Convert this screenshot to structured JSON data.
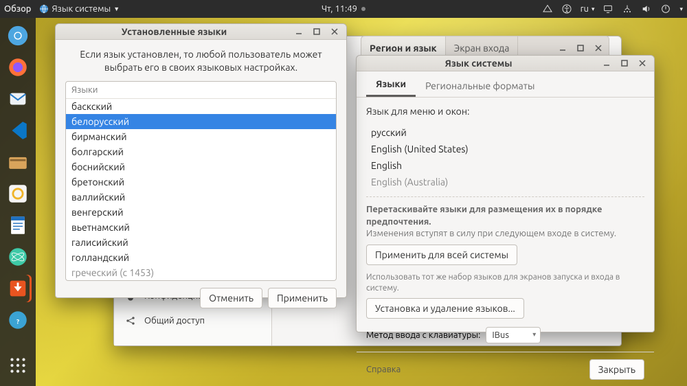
{
  "topbar": {
    "overview": "Обзор",
    "app_indicator": "Язык системы",
    "caret": "▼",
    "clock": "Чт, 11:49",
    "lang_indicator": "ru",
    "lang_caret": "▾"
  },
  "settings_window": {
    "sidebar": {
      "privacy": "Конфиденциальность",
      "sharing": "Общий доступ"
    },
    "plus": "+"
  },
  "region_tabs": {
    "tab1": "Регион и язык",
    "tab2": "Экран входа"
  },
  "lang_window": {
    "title": "Язык системы",
    "tab_languages": "Языки",
    "tab_formats": "Региональные форматы",
    "menu_label": "Язык для меню и окон:",
    "rows": {
      "r0": "русский",
      "r1": "English (United States)",
      "r2": "English",
      "r3": "English (Australia)"
    },
    "drag_hint_bold": "Перетаскивайте языки для размещения их в порядке предпочтения.",
    "drag_hint_rest": "Изменения вступят в силу при следующем входе в систему.",
    "apply_all": "Применить для всей системы",
    "apply_hint": "Использовать тот же набор языков для экранов запуска и входа в систему.",
    "install_btn": "Установка и удаление языков...",
    "input_method_label": "Метод ввода с клавиатуры:",
    "input_method_value": "IBus",
    "help": "Справка",
    "close": "Закрыть"
  },
  "installed_window": {
    "title": "Установленные языки",
    "intro": "Если язык установлен, то любой пользователь может выбрать его в своих языковых настройках.",
    "list_header": "Языки",
    "items": {
      "i0": "баскский",
      "i1": "белорусский",
      "i2": "бирманский",
      "i3": "болгарский",
      "i4": "боснийский",
      "i5": "бретонский",
      "i6": "валлийский",
      "i7": "венгерский",
      "i8": "вьетнамский",
      "i9": "галисийский",
      "i10": "голландский",
      "i11": "греческий (с 1453)"
    },
    "cancel": "Отменить",
    "apply": "Применить"
  }
}
